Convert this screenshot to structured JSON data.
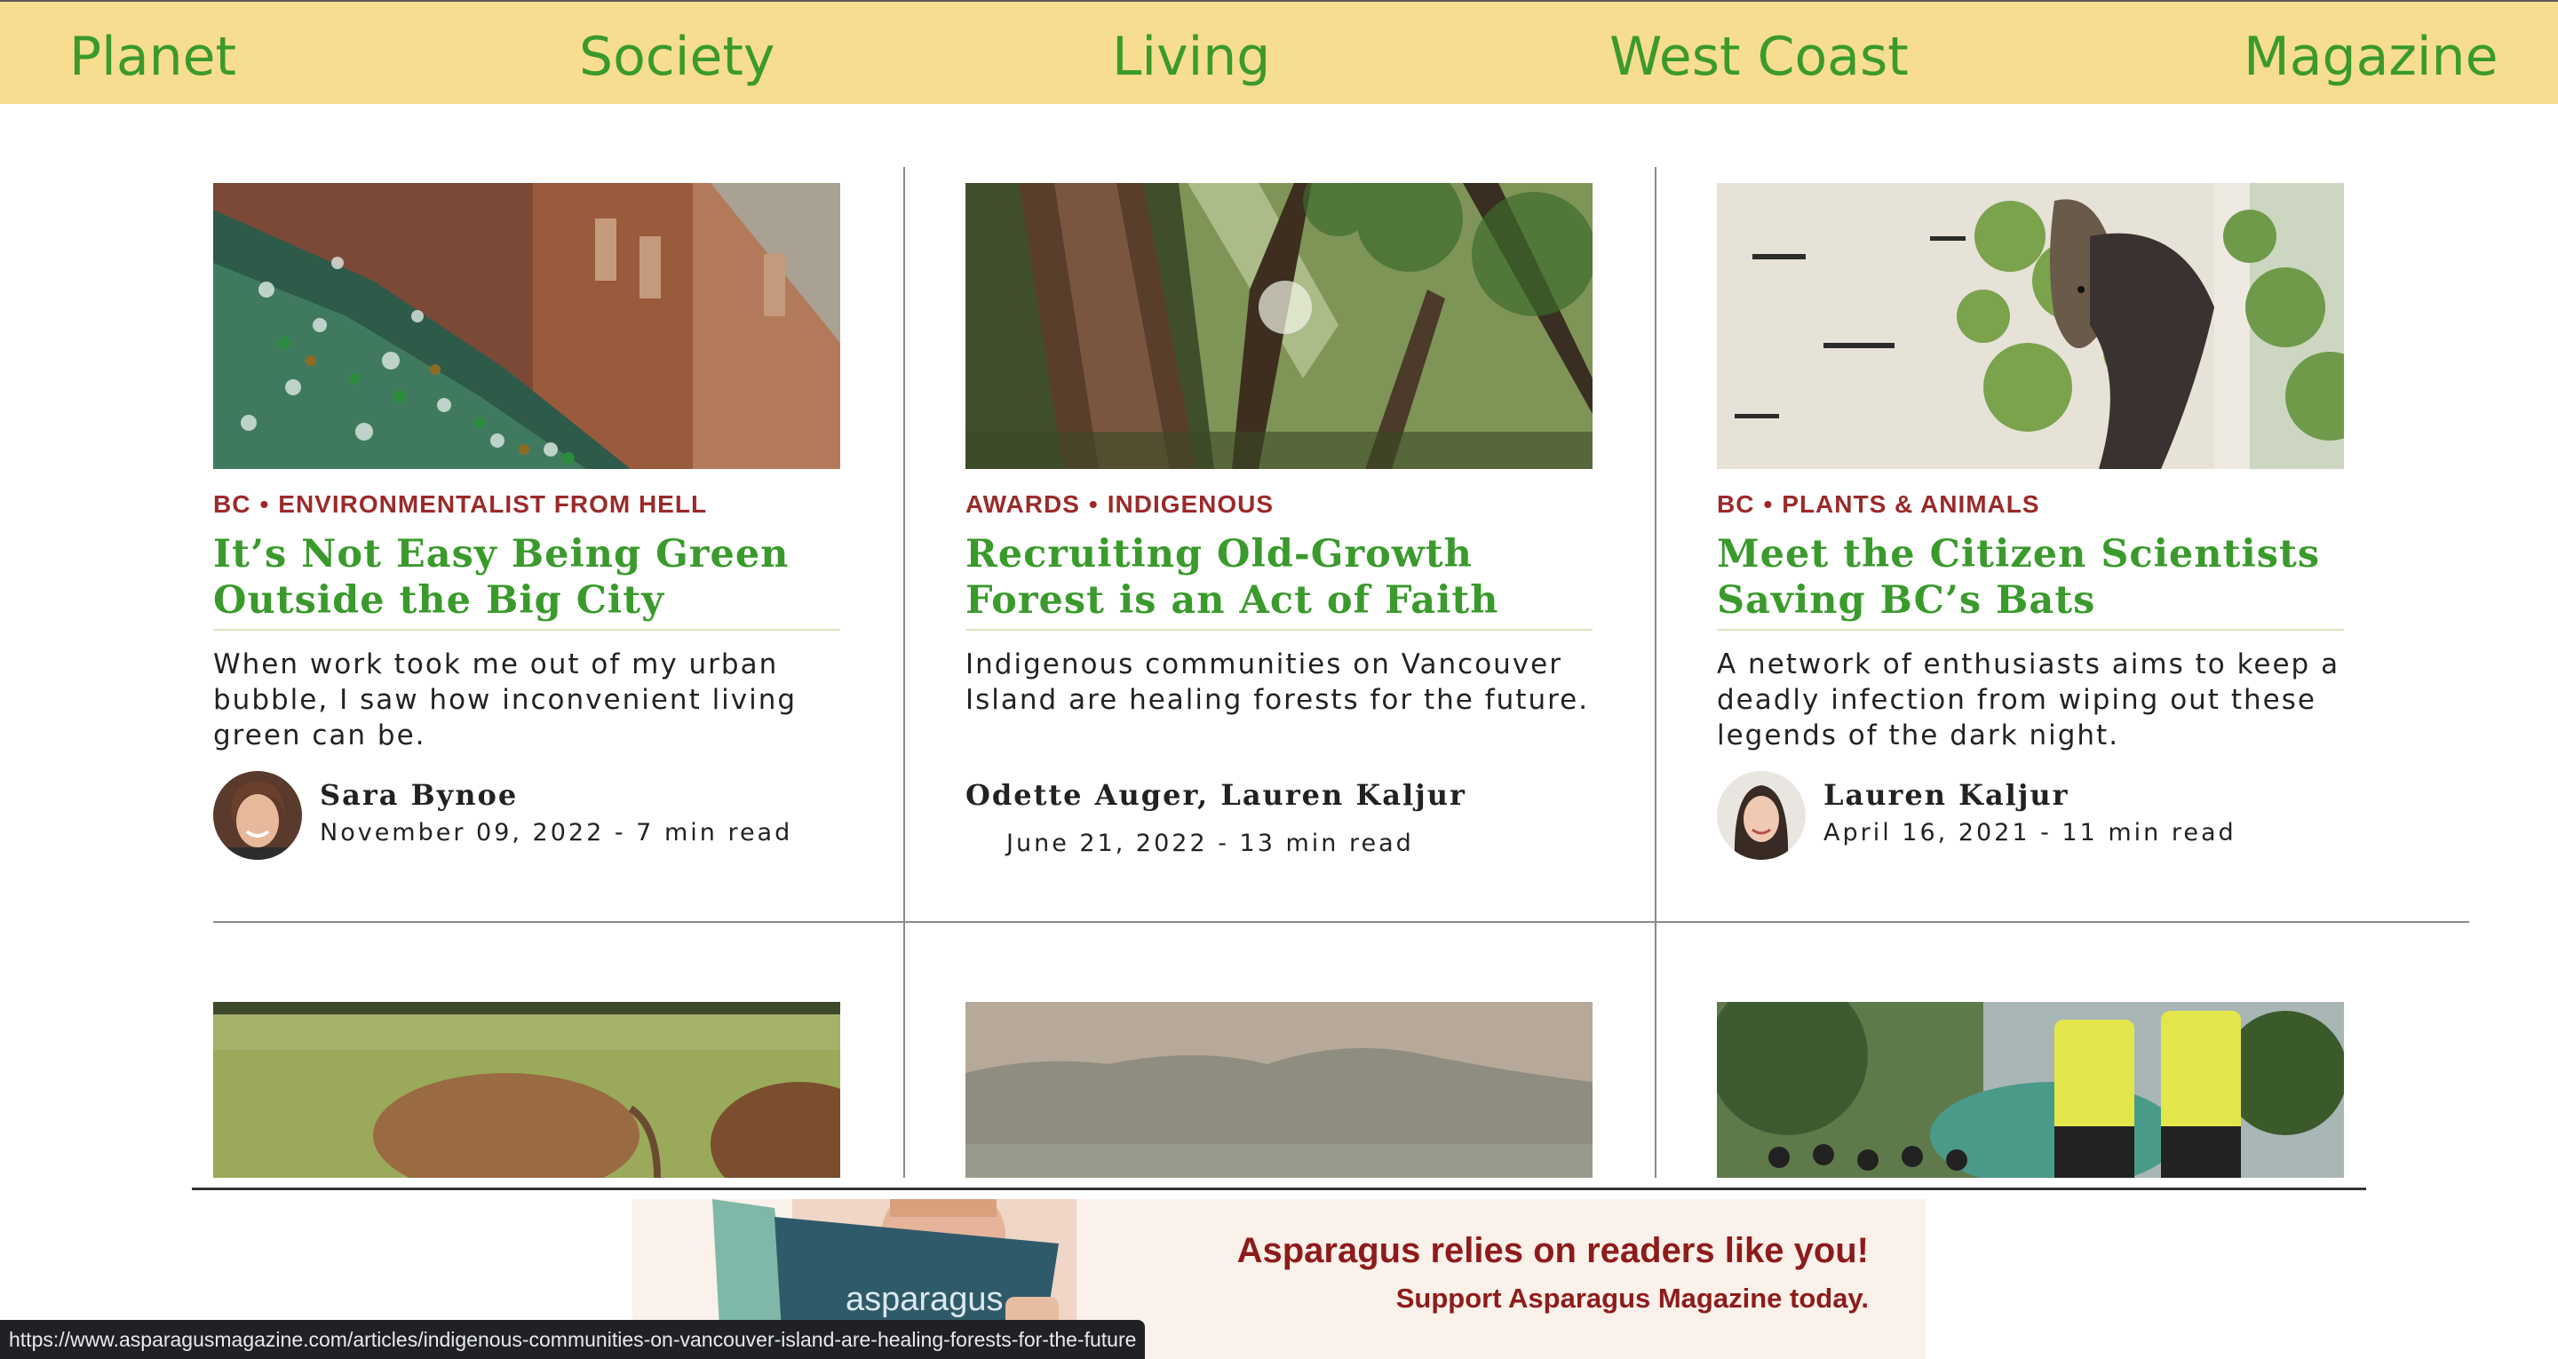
{
  "nav": {
    "items": [
      "Planet",
      "Society",
      "Living",
      "West Coast",
      "Magazine"
    ]
  },
  "articles": [
    {
      "category1": "BC",
      "category2": "ENVIRONMENTALIST FROM HELL",
      "title": "It’s Not Easy Being Green Outside the Big City",
      "excerpt": "When work took me out of my urban bubble, I saw how inconvenient living green can be.",
      "author": "Sara Bynoe",
      "meta": "November 09, 2022 - 7 min read"
    },
    {
      "category1": "AWARDS",
      "category2": "INDIGENOUS",
      "title": "Recruiting Old-Growth Forest is an Act of Faith",
      "excerpt": "Indigenous communities on Vancouver Island are healing forests for the future.",
      "author": "Odette Auger, Lauren Kaljur",
      "meta": "June 21, 2022 - 13 min read"
    },
    {
      "category1": "BC",
      "category2": "PLANTS & ANIMALS",
      "title": "Meet the Citizen Scientists Saving BC’s Bats",
      "excerpt": "A network of enthusiasts aims to keep a deadly infection from wiping out these legends of the dark night.",
      "author": "Lauren Kaljur",
      "meta": "April 16, 2021 - 11 min read"
    }
  ],
  "separator": "•",
  "banner": {
    "headline": "Asparagus relies on readers like you!",
    "subline": "Support Asparagus Magazine today.",
    "magazine_logo": "asparagus"
  },
  "status_url": "https://www.asparagusmagazine.com/articles/indigenous-communities-on-vancouver-island-are-healing-forests-for-the-future",
  "colors": {
    "nav_bg": "#f7dd8f",
    "brand_green": "#3a9a2c",
    "category_red": "#9b2a2a"
  }
}
